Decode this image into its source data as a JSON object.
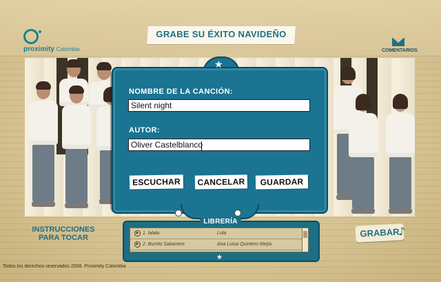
{
  "header": {
    "logo_text": "proximity",
    "logo_subtext": "Colombia",
    "title": "GRABE SU ÉXITO NAVIDEÑO",
    "comments_label": "COMENTARIOS"
  },
  "dialog": {
    "song_label": "NOMBRE DE LA CANCIÓN:",
    "song_value": "Silent night",
    "author_label": "AUTOR:",
    "author_value": "Oliver Castelblanco",
    "buttons": {
      "listen": "ESCUCHAR",
      "cancel": "CANCELAR",
      "save": "GUARDAR"
    }
  },
  "instructions": {
    "line1": "INSTRUCCIONES",
    "line2": "PARA TOCAR"
  },
  "library": {
    "title": "LIBRERÍA",
    "rows": [
      {
        "song": "1. lalala",
        "author": "Lola"
      },
      {
        "song": "2. Burrito Sabanero",
        "author": "Ana Luisa Quintero Mejía"
      }
    ]
  },
  "record_button": "GRABAR",
  "footer_text": "Todos los derechos reservados 2008. Proximity Colombia",
  "colors": {
    "accent": "#1b7491",
    "background": "#d9c89a"
  }
}
